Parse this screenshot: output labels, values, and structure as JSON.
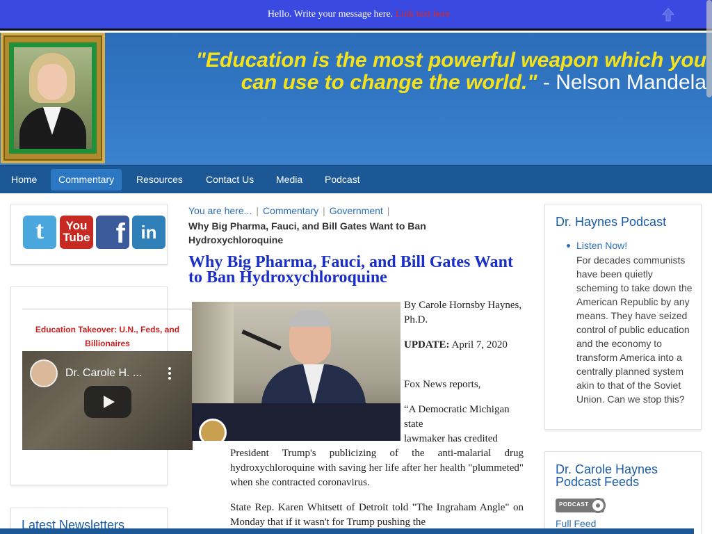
{
  "topbar": {
    "message": "Hello. Write your message here.",
    "link_label": "Link text here"
  },
  "header": {
    "quote": "\"Education is the most powerful weapon which you can use to change the world.\"",
    "quote_line1": "\"Education is the most powerful weapon which you",
    "quote_line2": "can use to change the world.\"",
    "quote_author": " - Nelson Mandela"
  },
  "nav": {
    "items": [
      {
        "label": "Home"
      },
      {
        "label": "Commentary",
        "active": true
      },
      {
        "label": "Resources"
      },
      {
        "label": "Contact Us"
      },
      {
        "label": "Media"
      },
      {
        "label": "Podcast"
      }
    ]
  },
  "social": {
    "icons": [
      {
        "name": "twitter-icon",
        "label": "t",
        "color": "#4aa7dd"
      },
      {
        "name": "youtube-icon",
        "label": "You Tube",
        "color": "#c62a22"
      },
      {
        "name": "facebook-icon",
        "label": "f",
        "color": "#3b5b9a"
      },
      {
        "name": "linkedin-icon",
        "label": "in",
        "color": "#2f7fb8"
      }
    ]
  },
  "video_widget": {
    "title": "Education Takeover: U.N., Feds, and Billionaires",
    "channel_title": "Dr. Carole H. ..."
  },
  "newsletters": {
    "title": "Latest Newsletters"
  },
  "breadcrumb": {
    "you_are_here": "You are here...",
    "items": [
      "Commentary",
      "Government"
    ],
    "current": "Why Big Pharma, Fauci, and Bill Gates Want to Ban Hydroxychloroquine"
  },
  "article": {
    "title": "Why Big Pharma, Fauci, and Bill Gates Want to Ban Hydroxychloroquine",
    "byline": "By Carole Hornsby Haynes, Ph.D.",
    "update_label": "UPDATE:",
    "update_date": "April 7, 2020",
    "source_line": "Fox News reports,",
    "quote_part1": "“A Democratic Michigan state",
    "quote_part2": "lawmaker has credited",
    "quote_part3": "President Trump's publicizing of the anti-malarial drug hydroxychloroquine with saving her life after her health \"plummeted\" when she contracted coronavirus.",
    "para2": "State Rep. Karen Whitsett of Detroit told \"The Ingraham Angle\" on Monday that if it wasn't for Trump pushing the"
  },
  "podcast_panel": {
    "title": "Dr. Haynes Podcast",
    "link_label": "Listen Now!",
    "description": "For decades communists have been quietly scheming to take down the American Republic by any means. They have seized control of public education and the economy to transform America into a centrally planned system akin to that of the Soviet Union. Can we stop this?"
  },
  "feeds_panel": {
    "title": "Dr. Carole Haynes Podcast Feeds",
    "badge_text": "PODCAST",
    "full_feed_label": "Full Feed"
  }
}
